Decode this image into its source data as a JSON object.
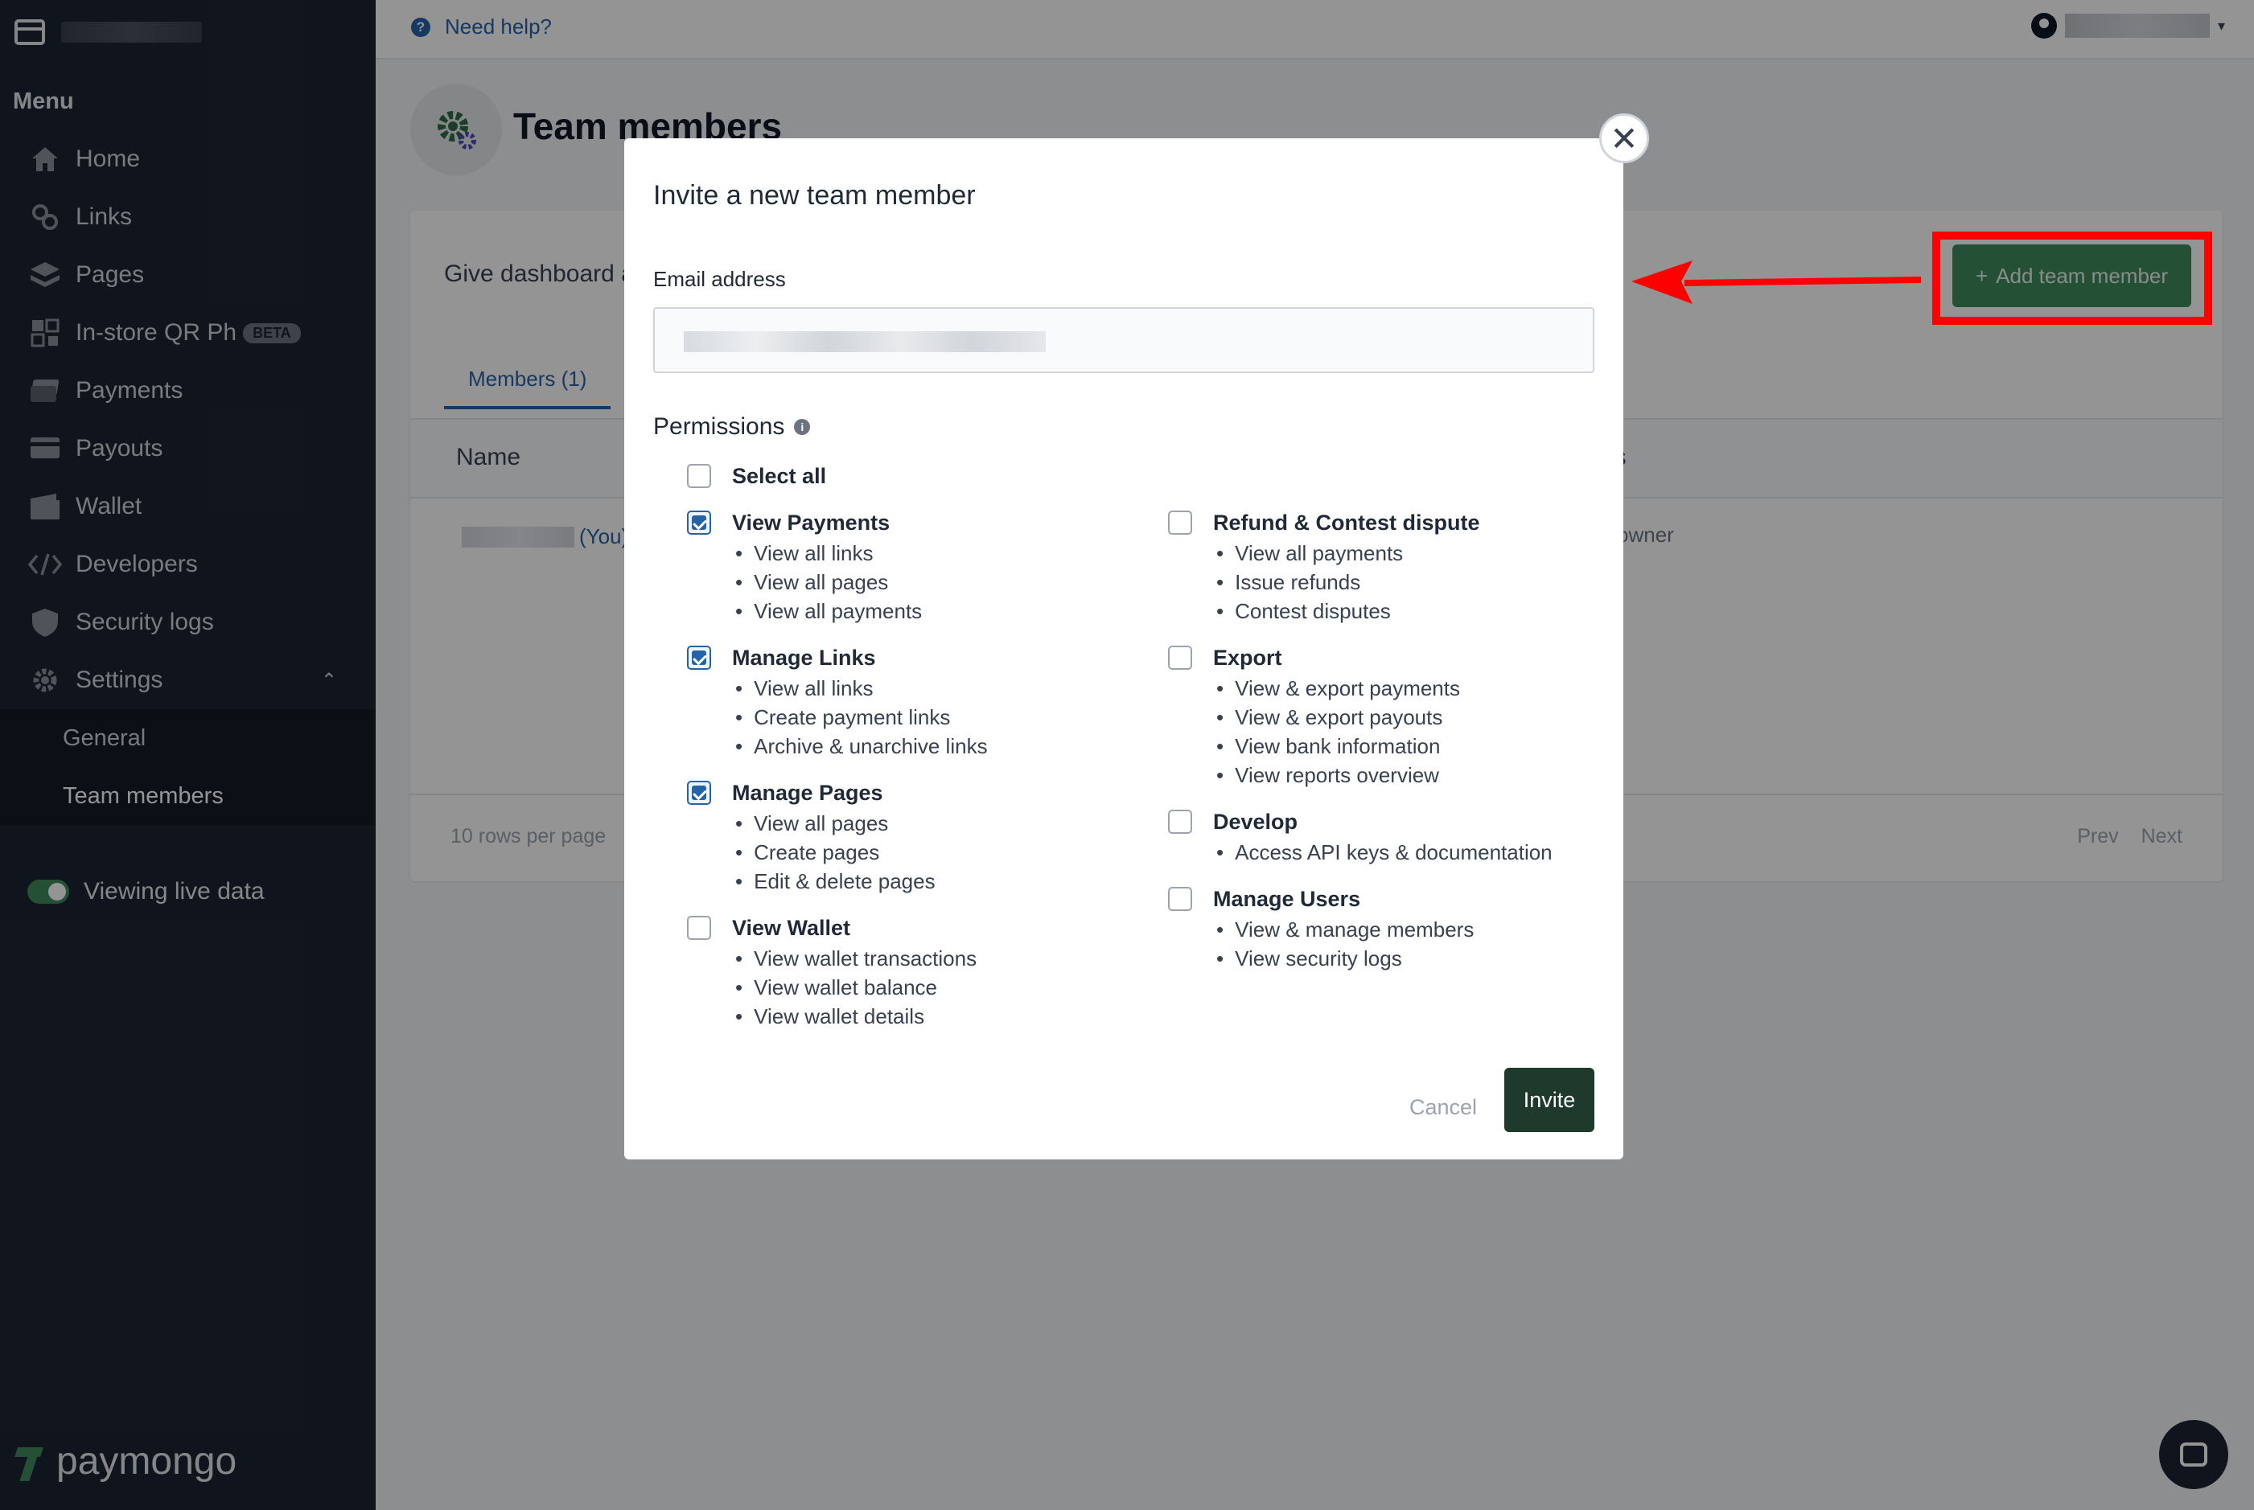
{
  "sidebar": {
    "menu_title": "Menu",
    "items": [
      {
        "label": "Home",
        "icon": "home-icon"
      },
      {
        "label": "Links",
        "icon": "links-icon"
      },
      {
        "label": "Pages",
        "icon": "pages-icon"
      },
      {
        "label": "In-store QR Ph",
        "icon": "qr-icon",
        "badge": "BETA"
      },
      {
        "label": "Payments",
        "icon": "payments-icon"
      },
      {
        "label": "Payouts",
        "icon": "payouts-icon"
      },
      {
        "label": "Wallet",
        "icon": "wallet-icon"
      },
      {
        "label": "Developers",
        "icon": "code-icon"
      },
      {
        "label": "Security logs",
        "icon": "shield-icon"
      },
      {
        "label": "Settings",
        "icon": "gear-icon"
      }
    ],
    "settings_sub": [
      {
        "label": "General"
      },
      {
        "label": "Team members"
      }
    ],
    "live_toggle_label": "Viewing live data",
    "logo_text": "paymongo"
  },
  "topbar": {
    "help_label": "Need help?"
  },
  "page": {
    "title": "Team members",
    "description": "Give dashboard a",
    "add_button": "Add team member",
    "add_button_icon": "+",
    "tab_members": "Members (1)",
    "col_name": "Name",
    "col_permissions": "ns",
    "row_you": "(You)",
    "row_role": "owner",
    "rows_per_page": "10 rows per page",
    "prev": "Prev",
    "next": "Next"
  },
  "modal": {
    "title": "Invite a new team member",
    "email_label": "Email address",
    "permissions_heading": "Permissions",
    "select_all": "Select all",
    "left_groups": [
      {
        "label": "View Payments",
        "checked": true,
        "items": [
          "View all links",
          "View all pages",
          "View all payments"
        ]
      },
      {
        "label": "Manage Links",
        "checked": true,
        "items": [
          "View all links",
          "Create payment links",
          "Archive & unarchive links"
        ]
      },
      {
        "label": "Manage Pages",
        "checked": true,
        "items": [
          "View all pages",
          "Create pages",
          "Edit & delete pages"
        ]
      },
      {
        "label": "View Wallet",
        "checked": false,
        "items": [
          "View wallet transactions",
          "View wallet balance",
          "View wallet details"
        ]
      }
    ],
    "right_groups": [
      {
        "label": "Refund & Contest dispute",
        "checked": false,
        "items": [
          "View all payments",
          "Issue refunds",
          "Contest disputes"
        ]
      },
      {
        "label": "Export",
        "checked": false,
        "items": [
          "View & export payments",
          "View & export payouts",
          "View bank information",
          "View reports overview"
        ]
      },
      {
        "label": "Develop",
        "checked": false,
        "items": [
          "Access API keys & documentation"
        ]
      },
      {
        "label": "Manage Users",
        "checked": false,
        "items": [
          "View & manage members",
          "View security logs"
        ]
      }
    ],
    "cancel_label": "Cancel",
    "invite_label": "Invite"
  },
  "colors": {
    "sidebar_bg": "#1b2433",
    "brand_green": "#3f8a5c",
    "link_blue": "#2563a8",
    "invite_bg": "#1d3a2c",
    "highlight_red": "#ff0000"
  }
}
